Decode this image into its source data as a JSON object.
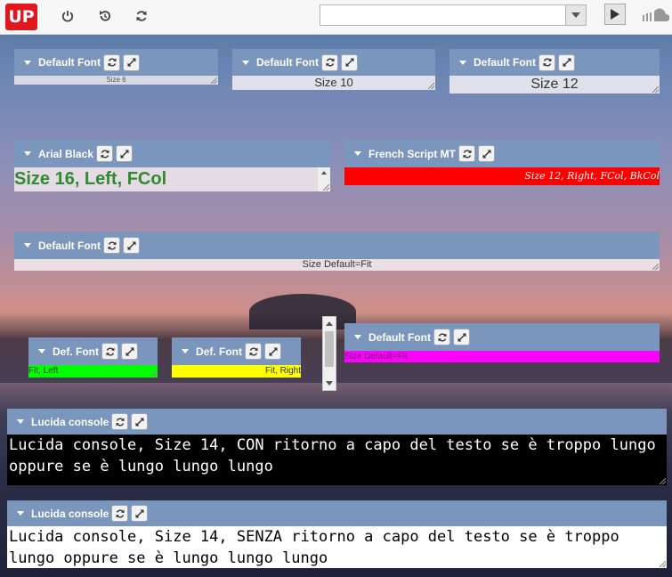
{
  "app": {
    "logo_text": "UP"
  },
  "toolbar": {
    "icons": [
      "power-icon",
      "history-icon",
      "refresh-icon"
    ],
    "combo_value": "",
    "play_icon": "play-icon",
    "cloud_icon": "cloud-icon"
  },
  "widgets": [
    {
      "id": "w1",
      "title": "Default Font",
      "text": "Size 6",
      "align": "center",
      "color": "#555555",
      "bg": "#d8dbe6"
    },
    {
      "id": "w2",
      "title": "Default Font",
      "text": "Size 10",
      "align": "center",
      "color": "#333333",
      "bg": "#dfe0ea"
    },
    {
      "id": "w3",
      "title": "Default Font",
      "text": "Size 12",
      "align": "center",
      "color": "#333333",
      "bg": "#dfe0ea"
    },
    {
      "id": "w4",
      "title": "Arial Black",
      "text": "Size 16, Left, FCol",
      "align": "left",
      "color": "#2e8b2e",
      "bg": "#e4dbe4"
    },
    {
      "id": "w5",
      "title": "French Script MT",
      "text": "Size 12, Right, FCol, BkCol",
      "align": "right",
      "color": "#ffffff",
      "bg": "#ff0000"
    },
    {
      "id": "w6",
      "title": "Default Font",
      "text": "Size Default=Fit",
      "align": "center",
      "color": "#333333",
      "bg": "#ecdfe3"
    },
    {
      "id": "w7",
      "title": "Def. Font",
      "text": "Fit, Left",
      "align": "left",
      "color": "#333333",
      "bg": "#00ff00"
    },
    {
      "id": "w8",
      "title": "Def. Font",
      "text": "Fit, Right",
      "align": "right",
      "color": "#333333",
      "bg": "#ffff00"
    },
    {
      "id": "w9",
      "title": "Default Font",
      "text": "Size Default=Fit",
      "align": "left",
      "color": "#6a1a6a",
      "bg": "#ff00ff"
    },
    {
      "id": "w10",
      "title": "Lucida console",
      "text": "Lucida console, Size 14, CON ritorno a capo del testo se è troppo lungo oppure se è lungo lungo lungo",
      "align": "left",
      "color": "#ffffff",
      "bg": "#000000"
    },
    {
      "id": "w11",
      "title": "Lucida console",
      "text": "Lucida console, Size 14, SENZA ritorno a capo del testo se è troppo lungo oppure se è lungo lungo lungo",
      "align": "left",
      "color": "#000000",
      "bg": "#ffffff"
    }
  ],
  "widget_buttons": {
    "refresh": "refresh-icon",
    "expand": "expand-icon"
  }
}
